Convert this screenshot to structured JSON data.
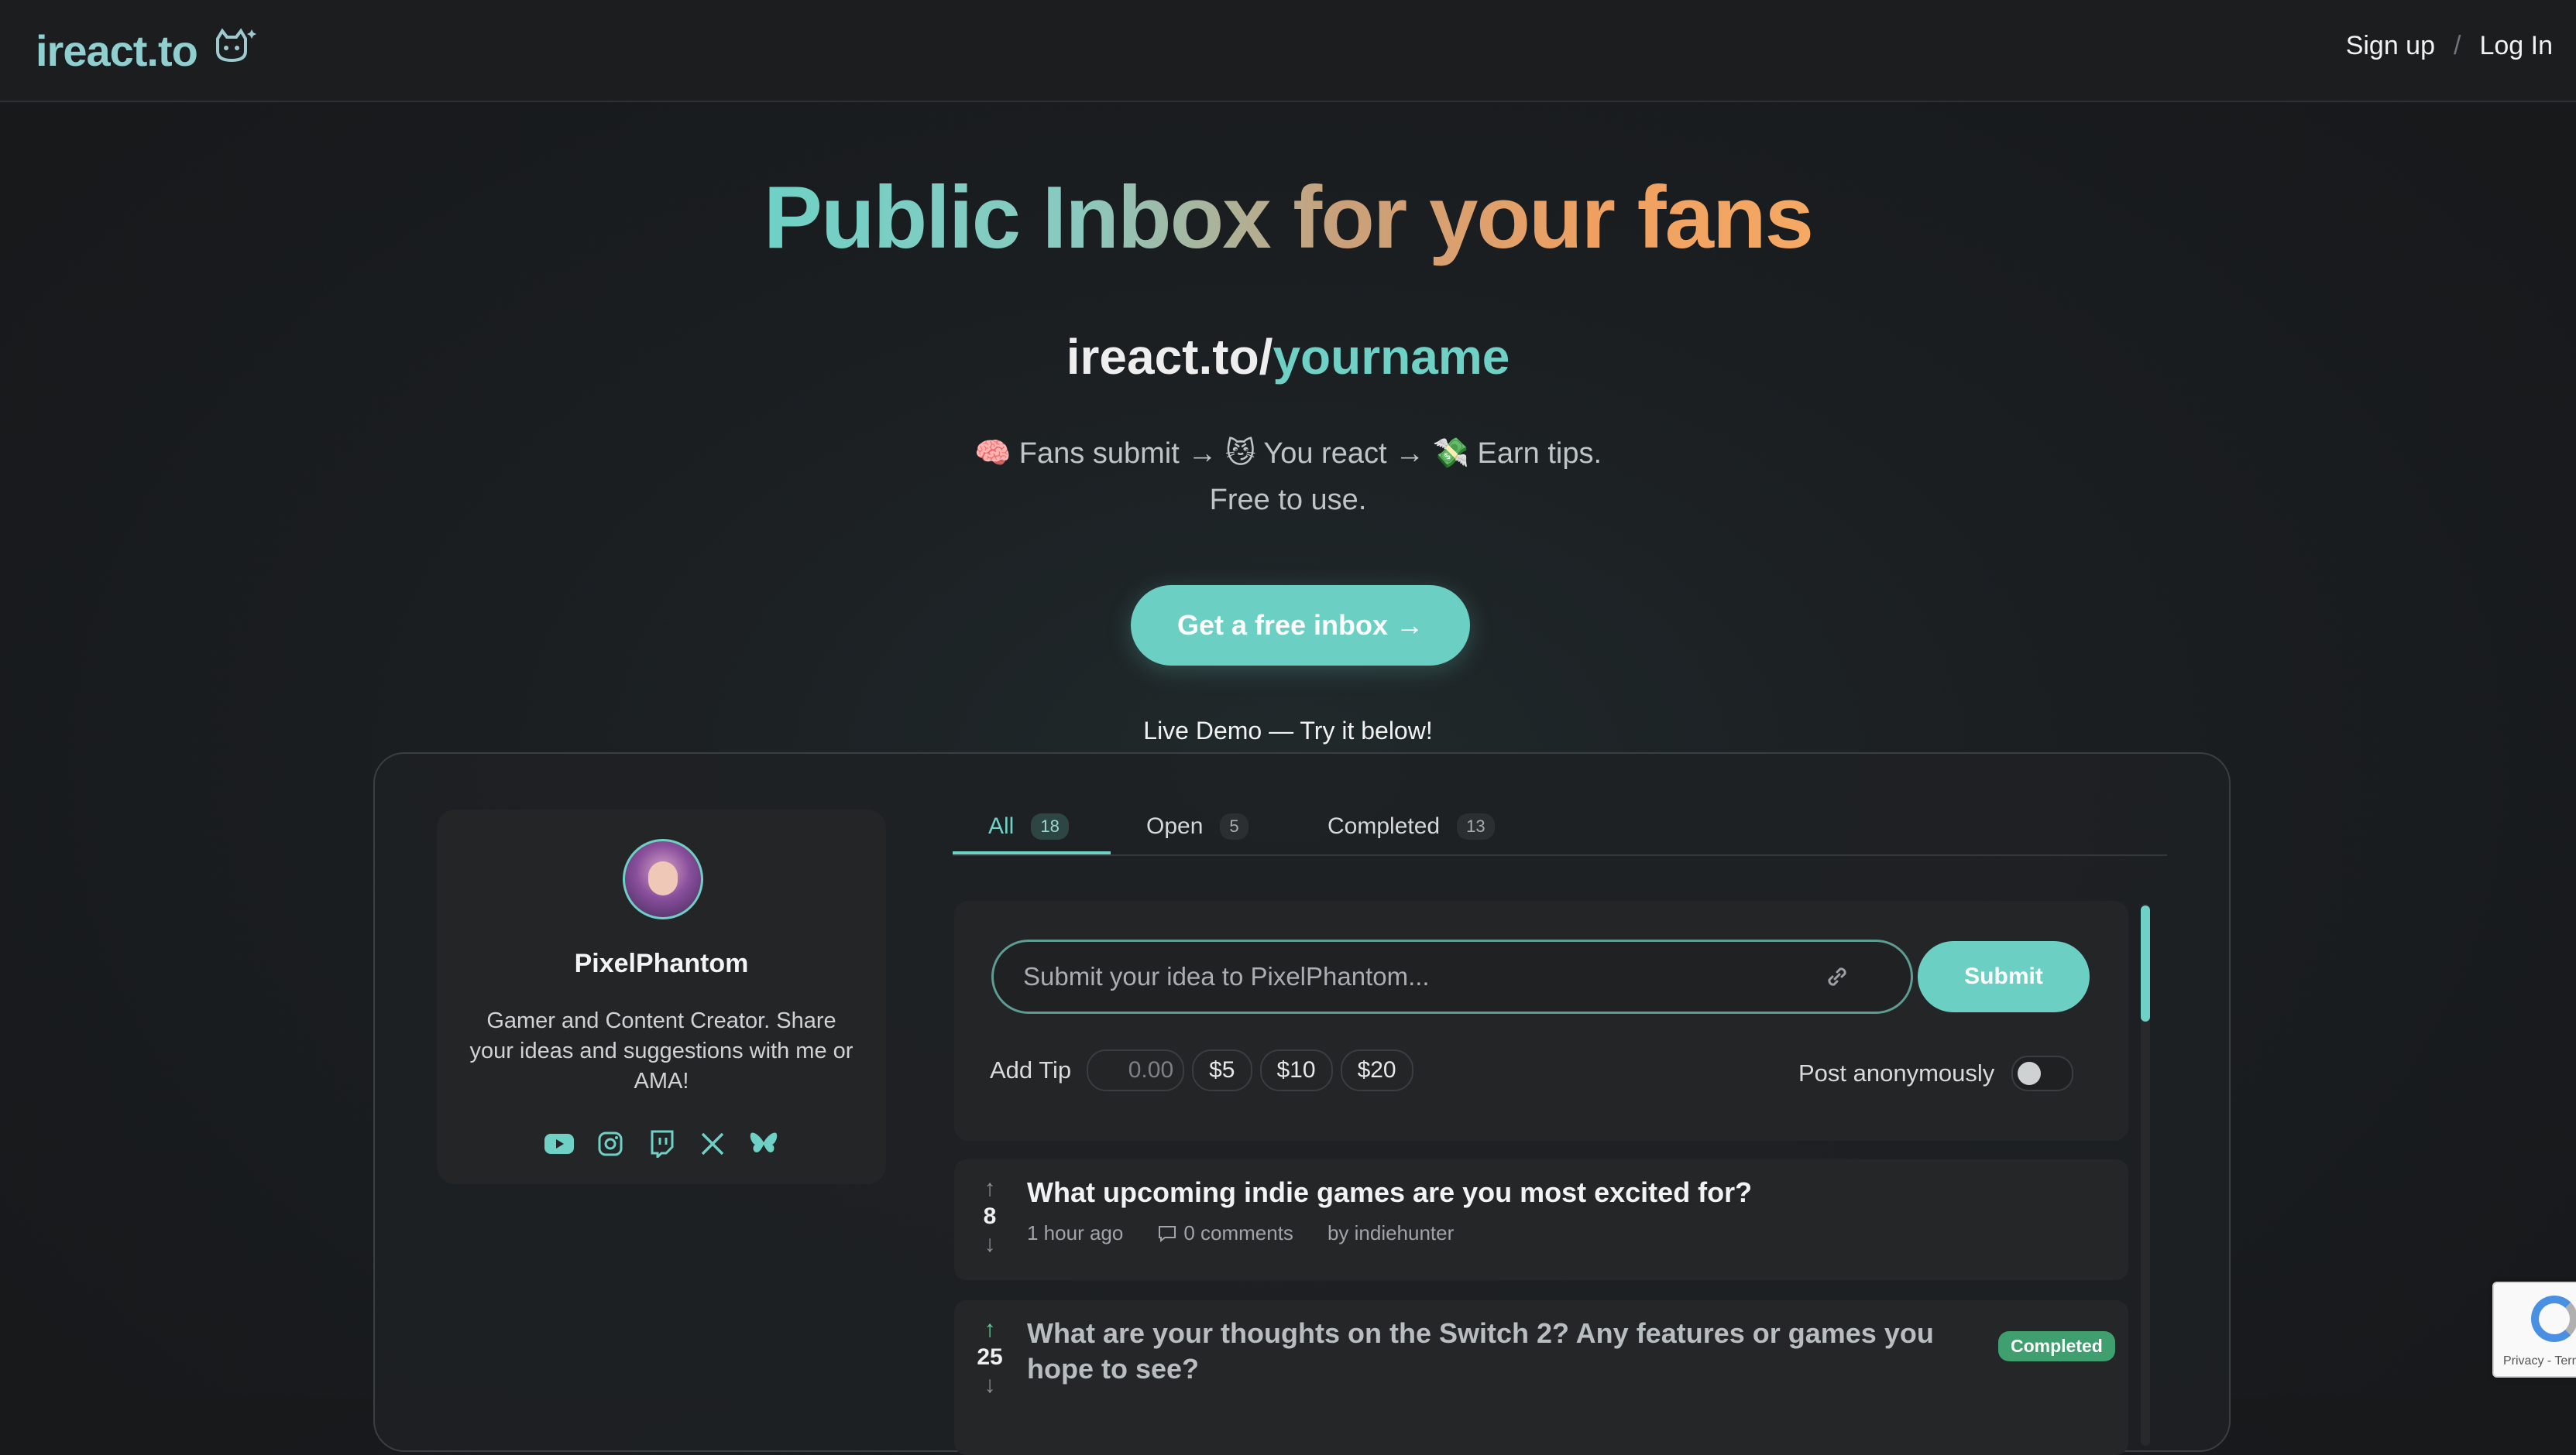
{
  "header": {
    "logo_text": "ireact.to",
    "logo_icon": "cat-icon",
    "signup": "Sign up",
    "separator": "/",
    "login": "Log In"
  },
  "hero": {
    "title": "Public Inbox for your fans",
    "url_base": "ireact.to/",
    "url_name": "yourname",
    "tagline": "🧠 Fans submit → 😼 You react → 💸 Earn tips.",
    "tagline2": "Free to use.",
    "cta": "Get a free inbox →",
    "demo_label": "Live Demo — Try it below!"
  },
  "profile": {
    "name": "PixelPhantom",
    "bio": "Gamer and Content Creator. Share your ideas and suggestions with me or AMA!",
    "socials": [
      "youtube-icon",
      "instagram-icon",
      "twitch-icon",
      "x-icon",
      "bluesky-icon"
    ]
  },
  "tabs": [
    {
      "label": "All",
      "count": "18"
    },
    {
      "label": "Open",
      "count": "5"
    },
    {
      "label": "Completed",
      "count": "13"
    }
  ],
  "composer": {
    "placeholder": "Submit your idea to PixelPhantom...",
    "submit": "Submit",
    "tip_label": "Add Tip",
    "tip_placeholder": "0.00",
    "tip_options": [
      "$5",
      "$10",
      "$20"
    ],
    "anonymous_label": "Post anonymously"
  },
  "posts": [
    {
      "votes": "8",
      "title": "What upcoming indie games are you most excited for?",
      "time": "1 hour ago",
      "comments": "0 comments",
      "author": "by indiehunter"
    },
    {
      "votes": "25",
      "title_line1": "What are your thoughts on the Switch 2? Any features or games you",
      "title_line2": "hope to see?",
      "status": "Completed"
    }
  ],
  "recaptcha": {
    "text": "Privacy - Terms"
  },
  "colors": {
    "accent": "#6ccfc4",
    "orange": "#f0a060",
    "completed": "#3f9f6e",
    "background": "#17191b"
  }
}
